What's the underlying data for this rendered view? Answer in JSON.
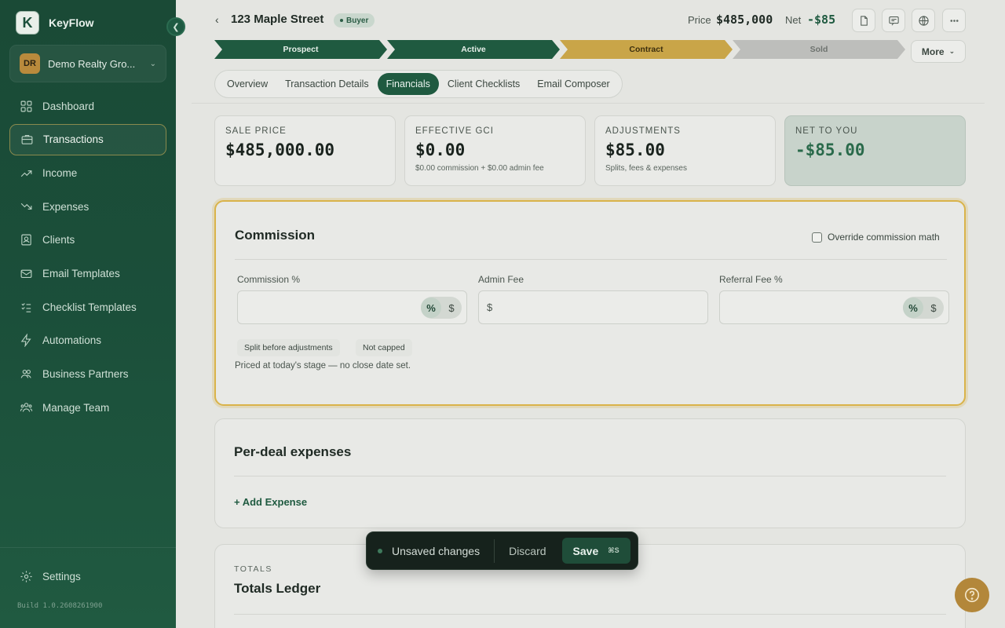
{
  "app": {
    "name": "KeyFlow",
    "logo_letter": "K",
    "build": "Build 1.0.2608261900"
  },
  "org": {
    "initials": "DR",
    "name": "Demo Realty Gro..."
  },
  "nav": [
    {
      "label": "Dashboard",
      "icon": "grid-icon"
    },
    {
      "label": "Transactions",
      "icon": "briefcase-icon"
    },
    {
      "label": "Income",
      "icon": "trend-up-icon"
    },
    {
      "label": "Expenses",
      "icon": "trend-down-icon"
    },
    {
      "label": "Clients",
      "icon": "contacts-icon"
    },
    {
      "label": "Email Templates",
      "icon": "mail-icon"
    },
    {
      "label": "Checklist Templates",
      "icon": "checklist-icon"
    },
    {
      "label": "Automations",
      "icon": "bolt-icon"
    },
    {
      "label": "Business Partners",
      "icon": "partners-icon"
    },
    {
      "label": "Manage Team",
      "icon": "team-icon"
    }
  ],
  "settings_label": "Settings",
  "header": {
    "title": "123 Maple Street",
    "badge": "Buyer",
    "price_label": "Price",
    "price_value": "$485,000",
    "net_label": "Net",
    "net_value": "-$85"
  },
  "stages": [
    "Prospect",
    "Active",
    "Contract",
    "Sold"
  ],
  "more_label": "More",
  "tabs": [
    "Overview",
    "Transaction Details",
    "Financials",
    "Client Checklists",
    "Email Composer"
  ],
  "cards": [
    {
      "label": "SALE PRICE",
      "value": "$485,000.00",
      "sub": ""
    },
    {
      "label": "EFFECTIVE GCI",
      "value": "$0.00",
      "sub": "$0.00 commission + $0.00 admin fee"
    },
    {
      "label": "ADJUSTMENTS",
      "value": "$85.00",
      "sub": "Splits, fees & expenses"
    },
    {
      "label": "NET TO YOU",
      "value": "-$85.00",
      "sub": ""
    }
  ],
  "commission": {
    "title": "Commission",
    "override_label": "Override commission math",
    "fields": [
      {
        "label": "Commission %",
        "value": ""
      },
      {
        "label": "Admin Fee",
        "value": ""
      },
      {
        "label": "Referral Fee %",
        "value": ""
      }
    ],
    "seg_percent": "%",
    "seg_dollar": "$",
    "currency_prefix": "$",
    "chips": [
      "Split before adjustments",
      "Not capped"
    ],
    "note": "Priced at today's stage — no close date set."
  },
  "expenses": {
    "title": "Per-deal expenses",
    "add_label": "+ Add Expense"
  },
  "totals": {
    "eyebrow": "TOTALS",
    "title": "Totals Ledger"
  },
  "toast": {
    "text": "Unsaved changes",
    "discard": "Discard",
    "save": "Save",
    "shortcut": "⌘S"
  }
}
